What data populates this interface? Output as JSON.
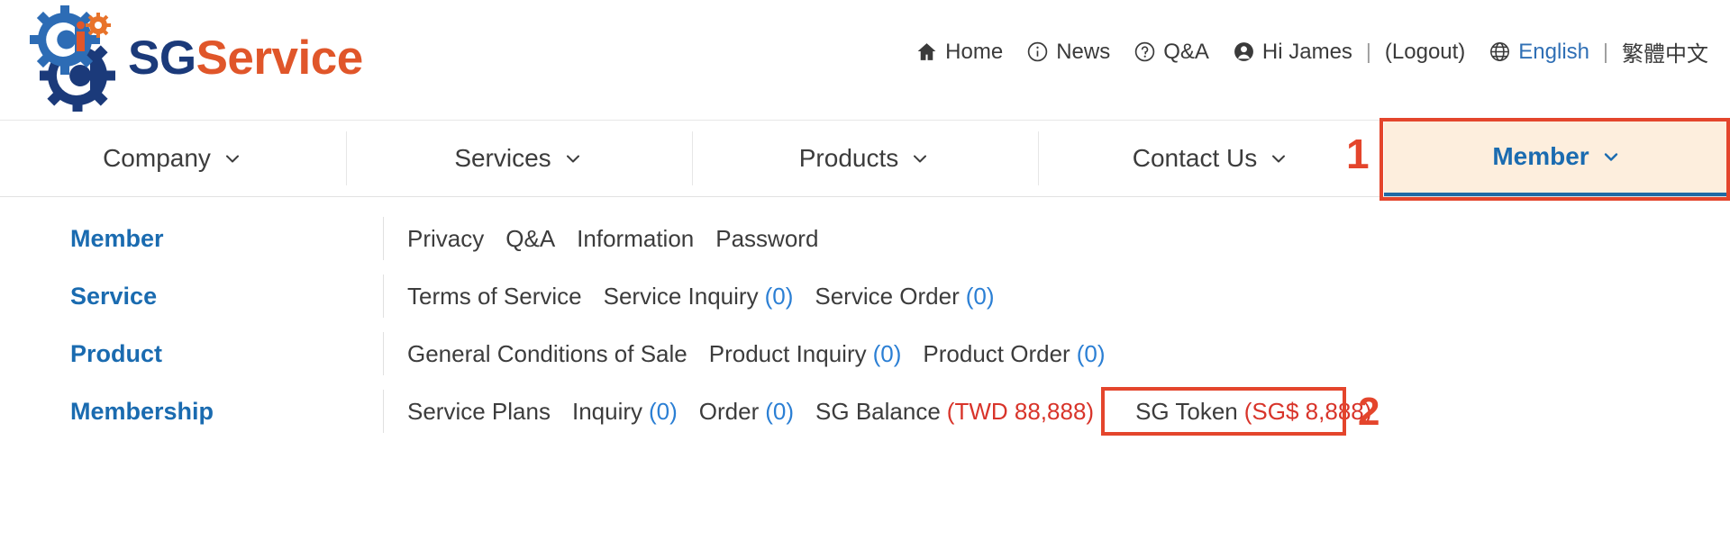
{
  "brand": {
    "logo_sg": "SG",
    "logo_service": "Service",
    "logo_icon": "gear-logo-icon"
  },
  "topbar": {
    "links": [
      {
        "label": "Home",
        "icon": "home-icon"
      },
      {
        "label": "News",
        "icon": "info-circle-icon"
      },
      {
        "label": "Q&A",
        "icon": "question-circle-icon"
      },
      {
        "label": "Hi James",
        "icon": "user-circle-icon"
      }
    ],
    "logout_label": "(Logout)",
    "separator": "|",
    "language": {
      "icon": "globe-icon",
      "active": "English",
      "separator": "|",
      "alternate": "繁體中文"
    }
  },
  "nav": {
    "items": [
      {
        "label": "Company",
        "active": false
      },
      {
        "label": "Services",
        "active": false
      },
      {
        "label": "Products",
        "active": false
      },
      {
        "label": "Contact Us",
        "active": false
      },
      {
        "label": "Member",
        "active": true
      }
    ],
    "chevron_icon": "chevron-down-icon"
  },
  "annotations": [
    {
      "number": "1",
      "target": "member-nav-tab"
    },
    {
      "number": "2",
      "target": "sg-token-link"
    }
  ],
  "dropdown": {
    "rows": [
      {
        "label": "Member",
        "links": [
          {
            "text": "Privacy"
          },
          {
            "text": "Q&A"
          },
          {
            "text": "Information"
          },
          {
            "text": "Password"
          }
        ]
      },
      {
        "label": "Service",
        "links": [
          {
            "text": "Terms of Service"
          },
          {
            "text": "Service Inquiry",
            "count": "(0)",
            "count_color": "blue"
          },
          {
            "text": "Service Order",
            "count": "(0)",
            "count_color": "blue"
          }
        ]
      },
      {
        "label": "Product",
        "links": [
          {
            "text": "General Conditions of Sale"
          },
          {
            "text": "Product Inquiry",
            "count": "(0)",
            "count_color": "blue"
          },
          {
            "text": "Product Order",
            "count": "(0)",
            "count_color": "blue"
          }
        ]
      },
      {
        "label": "Membership",
        "links": [
          {
            "text": "Service Plans"
          },
          {
            "text": "Inquiry",
            "count": "(0)",
            "count_color": "blue"
          },
          {
            "text": "Order",
            "count": "(0)",
            "count_color": "blue"
          },
          {
            "text": "SG Balance",
            "count": "(TWD 88,888)",
            "count_color": "red"
          },
          {
            "text": "SG Token",
            "count": "(SG$ 8,888)",
            "count_color": "red",
            "boxed": true
          }
        ]
      }
    ]
  },
  "colors": {
    "brand_navy": "#1b3a7a",
    "brand_orange": "#e0562a",
    "accent_blue": "#1a6bb0",
    "count_blue": "#2b7fd4",
    "count_red": "#d8342a",
    "annotation_red": "#e4452c",
    "active_tab_bg": "#fdeedd"
  }
}
